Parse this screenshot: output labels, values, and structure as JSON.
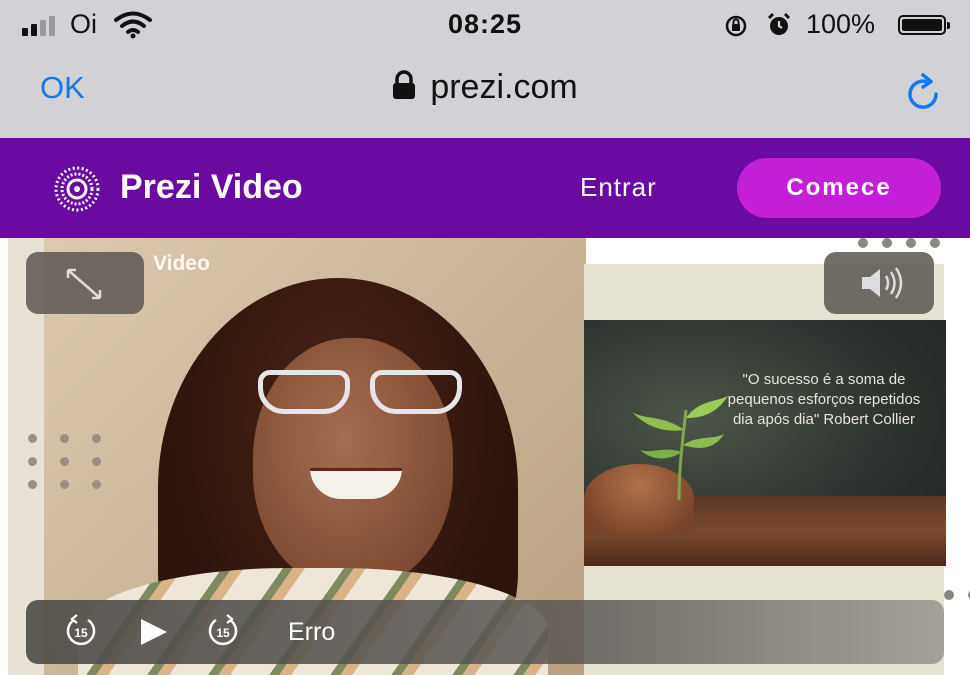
{
  "status_bar": {
    "carrier": "Oi",
    "time": "08:25",
    "battery": "100%",
    "battery_level": 1.0,
    "icons": [
      "signal-icon",
      "wifi-icon",
      "rotation-lock-icon",
      "alarm-icon",
      "battery-icon"
    ]
  },
  "browser": {
    "done_label": "OK",
    "url": "prezi.com",
    "icons": [
      "lock-icon",
      "reload-icon"
    ],
    "accent_color": "#1479e8"
  },
  "header": {
    "brand": "Prezi Video",
    "login": "Entrar",
    "cta": "Comece",
    "bg_color": "#6a0aa0",
    "cta_color": "#c21fd6"
  },
  "video": {
    "overlay_label": "Video",
    "quote": "\"O sucesso é a soma de pequenos esforços repetidos dia após dia\" Robert Collier",
    "controls": {
      "rewind_seconds": "15",
      "forward_seconds": "15",
      "status": "Erro"
    },
    "icons": [
      "expand-icon",
      "volume-icon",
      "rewind-15-icon",
      "play-icon",
      "forward-15-icon"
    ]
  }
}
